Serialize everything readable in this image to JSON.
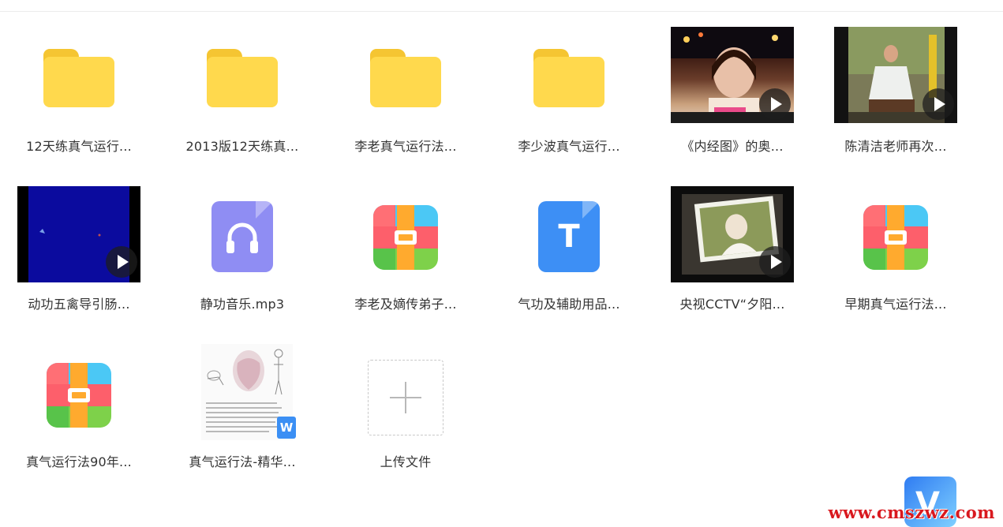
{
  "files": [
    {
      "label": "12天练真气运行...",
      "kind": "folder"
    },
    {
      "label": "2013版12天练真...",
      "kind": "folder"
    },
    {
      "label": "李老真气运行法...",
      "kind": "folder"
    },
    {
      "label": "李少波真气运行...",
      "kind": "folder"
    },
    {
      "label": "《内经图》的奥...",
      "kind": "video"
    },
    {
      "label": "陈清洁老师再次...",
      "kind": "video"
    },
    {
      "label": "动功五禽导引肠...",
      "kind": "video"
    },
    {
      "label": "静功音乐.mp3",
      "kind": "audio"
    },
    {
      "label": "李老及嫡传弟子...",
      "kind": "archive"
    },
    {
      "label": "气功及辅助用品...",
      "kind": "text-doc"
    },
    {
      "label": "央视CCTV“夕阳...",
      "kind": "video"
    },
    {
      "label": "早期真气运行法...",
      "kind": "archive"
    },
    {
      "label": "真气运行法90年...",
      "kind": "archive"
    },
    {
      "label": "真气运行法-精华...",
      "kind": "word-doc"
    }
  ],
  "upload": {
    "label": "上传文件",
    "icon": "plus-icon"
  },
  "doc_text_glyph": "T",
  "word_badge_glyph": "W",
  "watermark": {
    "text": "www.cmszwz.com",
    "logo_glyph": "V"
  },
  "colors": {
    "folder": "#ffd94d",
    "audio": "#8f8df3",
    "text_doc": "#3d8ff5",
    "word_badge": "#3b8ff4",
    "watermark": "#d9191f"
  }
}
